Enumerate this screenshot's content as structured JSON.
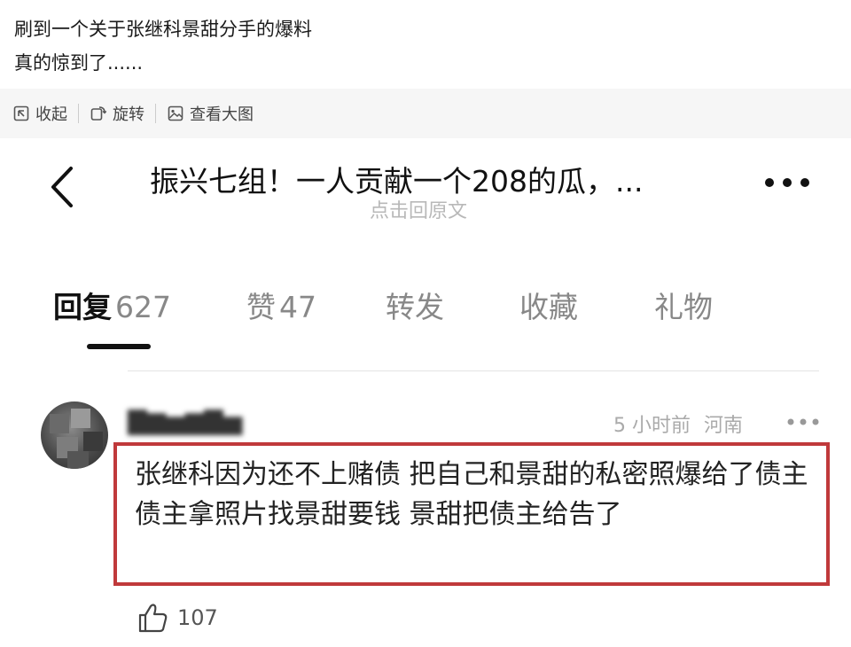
{
  "post": {
    "line1": "刷到一个关于张继科景甜分手的爆料",
    "line2": "真的惊到了......"
  },
  "toolbar": {
    "collapse": {
      "label": "收起",
      "icon": "collapse-icon"
    },
    "rotate": {
      "label": "旋转",
      "icon": "rotate-icon"
    },
    "view_large": {
      "label": "查看大图",
      "icon": "image-icon"
    }
  },
  "screenshot": {
    "title": "振兴七组！一人贡献一个208的瓜，...",
    "subtitle": "点击回原文",
    "tabs": [
      {
        "label": "回复",
        "count": "627",
        "active": true
      },
      {
        "label": "赞",
        "count": "47",
        "active": false
      },
      {
        "label": "转发",
        "count": "",
        "active": false
      },
      {
        "label": "收藏",
        "count": "",
        "active": false
      },
      {
        "label": "礼物",
        "count": "",
        "active": false
      }
    ],
    "comment": {
      "username": "▇▆▅▆▇▅",
      "time": "5 小时前",
      "location": "河南",
      "text": "张继科因为还不上赌债 把自己和景甜的私密照爆给了债主 债主拿照片找景甜要钱 景甜把债主给告了",
      "likes": "107"
    },
    "colors": {
      "highlight_border": "#c0393b",
      "tab_indicator": "#111111"
    }
  }
}
